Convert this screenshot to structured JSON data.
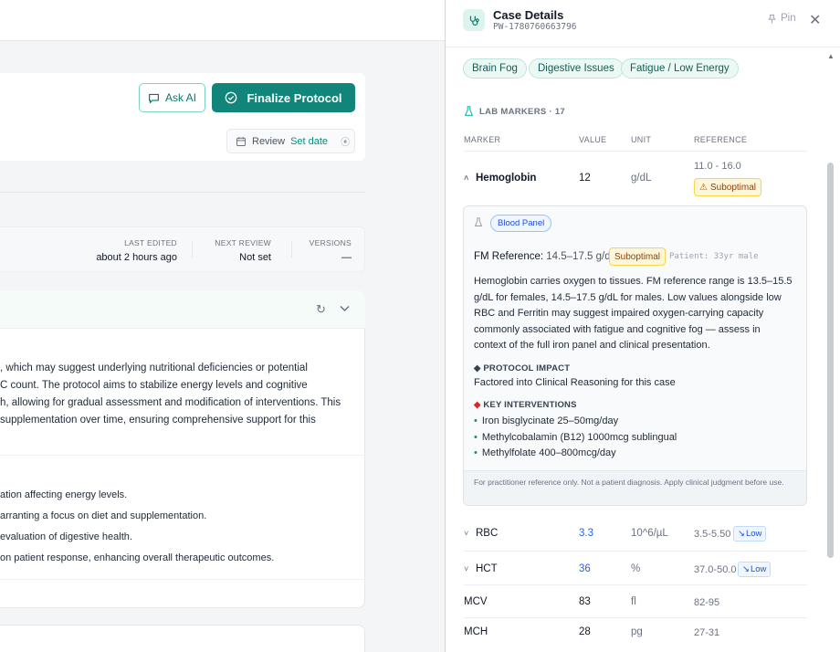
{
  "main": {
    "ask_ai_label": "Ask AI",
    "finalize_label": "Finalize Protocol",
    "review_label": "Review",
    "review_set_date": "Set date",
    "meta": {
      "last_edited_label": "LAST EDITED",
      "last_edited_value": "about 2 hours ago",
      "next_review_label": "NEXT REVIEW",
      "next_review_value": "Not set",
      "versions_label": "VERSIONS",
      "versions_value": "—"
    },
    "summary_lines": [
      ", which may suggest underlying nutritional deficiencies or potential",
      "C count. The protocol aims to stabilize energy levels and cognitive",
      "h, allowing for gradual assessment and modification of interventions. This",
      " supplementation over time, ensuring comprehensive support for this"
    ],
    "bullets": [
      "ation affecting energy levels.",
      "arranting a focus on diet and supplementation.",
      "evaluation of digestive health.",
      "on patient response, enhancing overall therapeutic outcomes."
    ]
  },
  "panel": {
    "title": "Case Details",
    "case_id": "PW-1780760663796",
    "pin_label": "Pin",
    "tags": [
      "Brain Fog",
      "Digestive Issues",
      "Fatigue / Low Energy"
    ],
    "lab_markers_title": "LAB MARKERS · 17",
    "columns": {
      "marker": "MARKER",
      "value": "VALUE",
      "unit": "UNIT",
      "reference": "REFERENCE"
    },
    "hemoglobin": {
      "name": "Hemoglobin",
      "value": "12",
      "unit": "g/dL",
      "reference": "11.0 - 16.0",
      "status": "Suboptimal"
    },
    "detail": {
      "panel_name": "Blood Panel",
      "fm_ref_label": "FM Reference:",
      "fm_ref_value": "14.5–17.5 g/dL",
      "fm_status": "Suboptimal",
      "patient": "Patient: 33yr male",
      "explanation": "Hemoglobin carries oxygen to tissues. FM reference range is 13.5–15.5 g/dL for females, 14.5–17.5 g/dL for males. Low values alongside low RBC and Ferritin may suggest impaired oxygen-carrying capacity commonly associated with fatigue and cognitive fog — assess in context of the full iron panel and clinical presentation.",
      "protocol_impact_title": "PROTOCOL IMPACT",
      "protocol_impact_text": "Factored into Clinical Reasoning for this case",
      "key_interventions_title": "KEY INTERVENTIONS",
      "interventions": [
        "Iron bisglycinate 25–50mg/day",
        "Methylcobalamin (B12) 1000mcg sublingual",
        "Methylfolate 400–800mcg/day"
      ],
      "disclaimer": "For practitioner reference only. Not a patient diagnosis. Apply clinical judgment before use."
    },
    "rows": [
      {
        "name": "RBC",
        "value": "3.3",
        "unit": "10^6/µL",
        "reference": "3.5-5.50",
        "flag": "Low"
      },
      {
        "name": "HCT",
        "value": "36",
        "unit": "%",
        "reference": "37.0-50.0",
        "flag": "Low"
      },
      {
        "name": "MCV",
        "value": "83",
        "unit": "fl",
        "reference": "82-95"
      },
      {
        "name": "MCH",
        "value": "28",
        "unit": "pg",
        "reference": "27-31"
      }
    ]
  }
}
